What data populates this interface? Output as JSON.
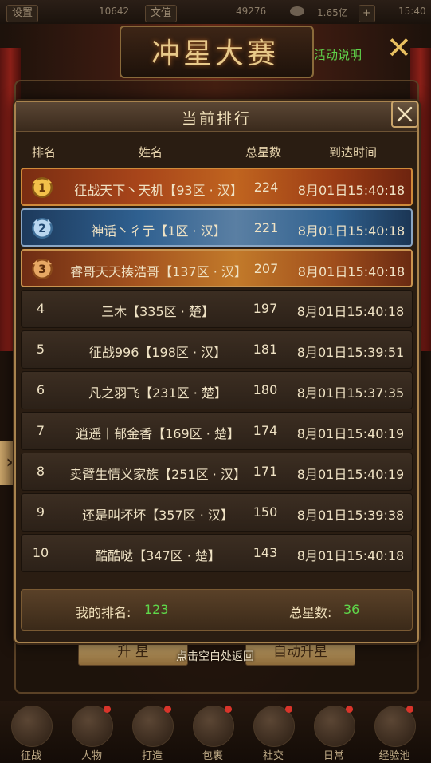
{
  "top_bar": {
    "settings_label": "设置",
    "value1": "10642",
    "vip_label": "文值",
    "value2": "49276",
    "value3": "1.65亿",
    "time": "15:40"
  },
  "banner": {
    "title": "冲星大赛",
    "event_link": "活动说明"
  },
  "modal": {
    "title": "当前排行",
    "columns": {
      "rank": "排名",
      "name": "姓名",
      "stars": "总星数",
      "time": "到达时间"
    },
    "rows": [
      {
        "rank": "1",
        "medal": "gold",
        "name": "征战天下丶天机【93区 · 汉】",
        "stars": "224",
        "time": "8月01日15:40:18"
      },
      {
        "rank": "2",
        "medal": "silver",
        "name": "神话丶彳亍【1区 · 汉】",
        "stars": "221",
        "time": "8月01日15:40:18"
      },
      {
        "rank": "3",
        "medal": "bronze",
        "name": "睿哥天天揍浩哥【137区 · 汉】",
        "stars": "207",
        "time": "8月01日15:40:18"
      },
      {
        "rank": "4",
        "medal": "",
        "name": "三木【335区 · 楚】",
        "stars": "197",
        "time": "8月01日15:40:18"
      },
      {
        "rank": "5",
        "medal": "",
        "name": "征战996【198区 · 汉】",
        "stars": "181",
        "time": "8月01日15:39:51"
      },
      {
        "rank": "6",
        "medal": "",
        "name": "凡之羽飞【231区 · 楚】",
        "stars": "180",
        "time": "8月01日15:37:35"
      },
      {
        "rank": "7",
        "medal": "",
        "name": "逍遥丨郁金香【169区 · 楚】",
        "stars": "174",
        "time": "8月01日15:40:19"
      },
      {
        "rank": "8",
        "medal": "",
        "name": "卖臂生情义家族【251区 · 汉】",
        "stars": "171",
        "time": "8月01日15:40:19"
      },
      {
        "rank": "9",
        "medal": "",
        "name": "还是叫坏坏【357区 · 汉】",
        "stars": "150",
        "time": "8月01日15:39:38"
      },
      {
        "rank": "10",
        "medal": "",
        "name": "酷酷哒【347区 · 楚】",
        "stars": "143",
        "time": "8月01日15:40:18"
      }
    ],
    "my_rank_label": "我的排名:",
    "my_rank_value": "123",
    "my_stars_label": "总星数:",
    "my_stars_value": "36"
  },
  "buttons": {
    "upgrade_star": "升 星",
    "auto_upgrade_star": "自动升星",
    "hint": "点击空白处返回"
  },
  "bottom_nav": [
    {
      "label": "征战",
      "icon": "campaign-icon",
      "dot": false
    },
    {
      "label": "人物",
      "icon": "character-icon",
      "dot": true
    },
    {
      "label": "打造",
      "icon": "forge-icon",
      "dot": true
    },
    {
      "label": "包裹",
      "icon": "bag-icon",
      "dot": true
    },
    {
      "label": "社交",
      "icon": "social-icon",
      "dot": true
    },
    {
      "label": "日常",
      "icon": "daily-icon",
      "dot": true
    },
    {
      "label": "经验池",
      "icon": "exp-pool-icon",
      "dot": true
    }
  ],
  "colors": {
    "accent_green": "#5fd84a",
    "gold_row": "#c0641f",
    "silver_row": "#30618f",
    "bronze_row": "#c27a2a"
  }
}
